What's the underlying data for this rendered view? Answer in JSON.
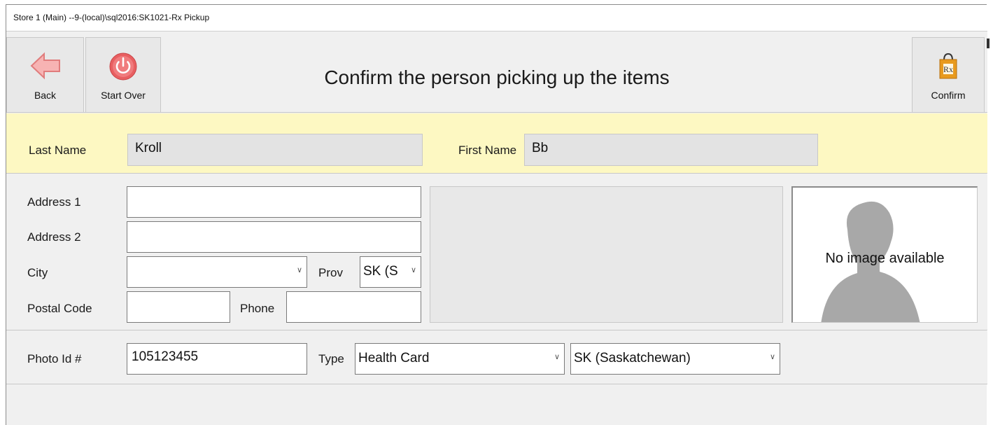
{
  "window": {
    "title": "Store 1 (Main) --9-(local)\\sql2016:SK1021-Rx Pickup"
  },
  "toolbar": {
    "back_label": "Back",
    "start_over_label": "Start Over",
    "heading": "Confirm the person picking up the items",
    "confirm_label": "Confirm"
  },
  "name": {
    "last_name_label": "Last Name",
    "last_name_value": "Kroll",
    "first_name_label": "First Name",
    "first_name_value": "Bb"
  },
  "address": {
    "address1_label": "Address 1",
    "address1_value": "",
    "address2_label": "Address 2",
    "address2_value": "",
    "city_label": "City",
    "city_value": "",
    "prov_label": "Prov",
    "prov_value": "SK (S",
    "postal_code_label": "Postal Code",
    "postal_code_value": "",
    "phone_label": "Phone",
    "phone_value": ""
  },
  "photo": {
    "placeholder_text": "No image available"
  },
  "photo_id": {
    "label": "Photo Id #",
    "value": "105123455",
    "type_label": "Type",
    "type_value": "Health Card",
    "jurisdiction_value": "SK (Saskatchewan)"
  },
  "colors": {
    "name_band": "#fdf8c2",
    "back_arrow": "#f4a3a3",
    "power_button": "#e8585a",
    "rx_bag": "#e89a1e"
  }
}
